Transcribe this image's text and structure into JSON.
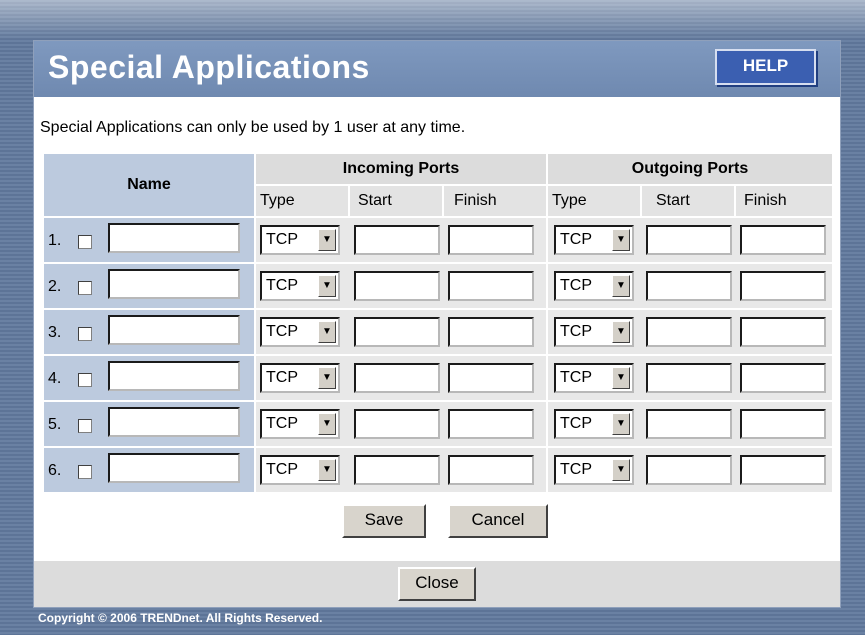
{
  "title": "Special Applications",
  "help_label": "HELP",
  "description": "Special Applications can only be used by 1 user at any time.",
  "table": {
    "name_header": "Name",
    "incoming_header": "Incoming Ports",
    "outgoing_header": "Outgoing Ports",
    "sub_headers": {
      "in_type": "Type",
      "in_start": "Start",
      "in_finish": "Finish",
      "out_type": "Type",
      "out_start": "Start",
      "out_finish": "Finish"
    },
    "rows": [
      {
        "num": "1.",
        "in_type": "TCP",
        "out_type": "TCP"
      },
      {
        "num": "2.",
        "in_type": "TCP",
        "out_type": "TCP"
      },
      {
        "num": "3.",
        "in_type": "TCP",
        "out_type": "TCP"
      },
      {
        "num": "4.",
        "in_type": "TCP",
        "out_type": "TCP"
      },
      {
        "num": "5.",
        "in_type": "TCP",
        "out_type": "TCP"
      },
      {
        "num": "6.",
        "in_type": "TCP",
        "out_type": "TCP"
      }
    ]
  },
  "buttons": {
    "save": "Save",
    "cancel": "Cancel",
    "close": "Close"
  },
  "copyright": "Copyright © 2006 TRENDnet. All Rights Reserved.",
  "colors": {
    "titlebar": "#7590b8",
    "help_button": "#3b5fb1",
    "name_column": "#bccade"
  }
}
